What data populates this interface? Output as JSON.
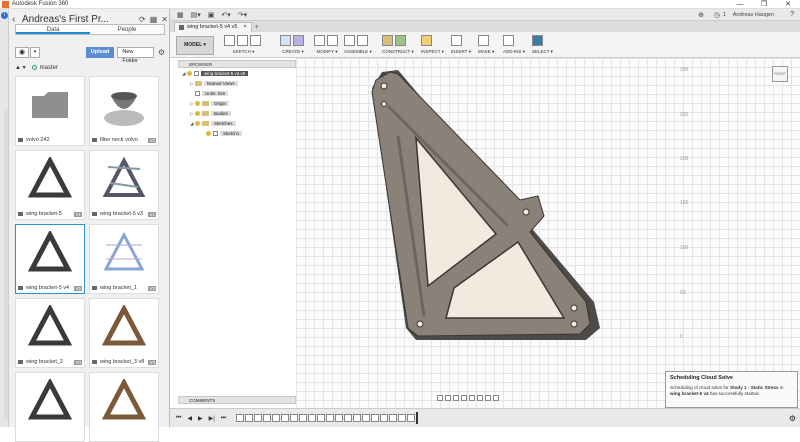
{
  "window": {
    "title": "Autodesk Fusion 360",
    "controls": [
      "—",
      "❐",
      "✕"
    ]
  },
  "data_panel": {
    "title": "Andreas's First Pr...",
    "tabs": [
      "Data",
      "People"
    ],
    "upload_label": "Upload",
    "new_folder_label": "New Folder",
    "branch": "master",
    "items": [
      {
        "name": "volvo 242",
        "badge": "",
        "kind": "folder"
      },
      {
        "name": "filter neck volvo",
        "badge": "V2",
        "kind": "filter"
      },
      {
        "name": "wing bracket-5",
        "badge": "V1",
        "kind": "bracket"
      },
      {
        "name": "wing bracket-5 v3",
        "badge": "V1",
        "kind": "bracket-assembly"
      },
      {
        "name": "wing bracket-5 v4",
        "badge": "V5",
        "kind": "bracket"
      },
      {
        "name": "wing bracket_1",
        "badge": "V3",
        "kind": "bracket-sketch"
      },
      {
        "name": "wing bracket_2",
        "badge": "V3",
        "kind": "bracket"
      },
      {
        "name": "wing bracket_3 v8",
        "badge": "V3",
        "kind": "bracket-bronze"
      },
      {
        "name": "",
        "badge": "",
        "kind": "bracket"
      },
      {
        "name": "",
        "badge": "",
        "kind": "bracket-bronze"
      }
    ]
  },
  "appbar": {
    "user": "Andreas Haugen",
    "help": "?",
    "count": "1"
  },
  "doc_tab": {
    "label": "wing bracket-5 v4 v5",
    "close": "×"
  },
  "ribbon": {
    "workspace": "MODEL ▾",
    "groups": [
      "SKETCH ▾",
      "CREATE ▾",
      "MODIFY ▾",
      "ASSEMBLE ▾",
      "CONSTRUCT ▾",
      "INSPECT ▾",
      "INSERT ▾",
      "MAKE ▾",
      "ADD-INS ▾",
      "SELECT ▾"
    ]
  },
  "browser": {
    "header": "BROWSER",
    "root": "wing bracket-5 v4 v5",
    "named_views": "Named Views",
    "units": "Units: mm",
    "origin": "Origin",
    "bodies": "Bodies",
    "sketches": "Sketches",
    "sketch1": "Sketch1"
  },
  "comments_label": "COMMENTS",
  "axis_labels": [
    "300",
    "250",
    "200",
    "150",
    "100",
    "50",
    "0"
  ],
  "viewcube_label": "FRONT",
  "toast": {
    "title": "Scheduling Cloud Solve",
    "line1": "Scheduling of cloud solve for ",
    "study": "Study 1 - Static Stress",
    "line2": " in ",
    "doc": "wing bracket-5 v4",
    "line3": " has successfully started."
  },
  "colors": {
    "accent": "#1a8fd8",
    "upload": "#5b8ed1",
    "part_body": "#8a8278",
    "part_face": "#f3e9de"
  }
}
